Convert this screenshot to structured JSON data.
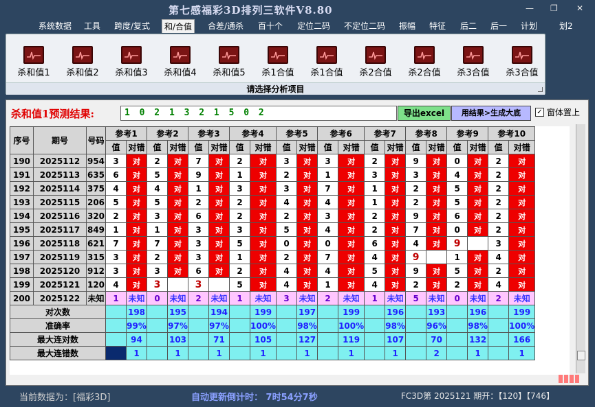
{
  "app": {
    "title": "第七感福彩3D排列三软件V8.80"
  },
  "window_controls": [
    "—",
    "❐",
    "✕"
  ],
  "menu": [
    "系统数据",
    "工具",
    "跨度/复式",
    "和/合值",
    "合差/通杀",
    "百十个",
    "定位二码",
    "不定位二码",
    "振幅",
    "特征",
    "后二",
    "后一",
    "计划",
    "划2"
  ],
  "menu_active": 3,
  "ribbon": {
    "tools": [
      "杀和值1",
      "杀和值2",
      "杀和值3",
      "杀和值4",
      "杀和值5",
      "杀1合值",
      "杀1合值",
      "杀2合值",
      "杀2合值",
      "杀3合值",
      "杀3合值"
    ],
    "caption": "请选择分析项目"
  },
  "panel": {
    "pred_label": "杀和值1预测结果:",
    "pred_value": "1 0 2 1 3 2 1 5 0 2",
    "export_label": "导出excel",
    "generate_label": "用结果>生成大底",
    "pin_label": "窗体置上",
    "pin_mark": "✓"
  },
  "table": {
    "col_headers": [
      "序号",
      "期号",
      "号码"
    ],
    "ref_headers": [
      "参考1",
      "参考2",
      "参考3",
      "参考4",
      "参考5",
      "参考6",
      "参考7",
      "参考8",
      "参考9",
      "参考10"
    ],
    "sub_headers": [
      "值",
      "对错"
    ],
    "hit_text": "对",
    "rows": [
      {
        "seq": "190",
        "issue": "2025112",
        "num": "954",
        "vals": [
          "3",
          "2",
          "7",
          "2",
          "3",
          "3",
          "2",
          "9",
          "0",
          "2"
        ],
        "miss": []
      },
      {
        "seq": "191",
        "issue": "2025113",
        "num": "635",
        "vals": [
          "6",
          "5",
          "9",
          "1",
          "2",
          "1",
          "3",
          "3",
          "4",
          "2"
        ],
        "miss": []
      },
      {
        "seq": "192",
        "issue": "2025114",
        "num": "375",
        "vals": [
          "4",
          "4",
          "1",
          "3",
          "3",
          "7",
          "1",
          "2",
          "5",
          "2"
        ],
        "miss": []
      },
      {
        "seq": "193",
        "issue": "2025115",
        "num": "206",
        "vals": [
          "5",
          "5",
          "2",
          "2",
          "4",
          "4",
          "1",
          "2",
          "5",
          "2"
        ],
        "miss": []
      },
      {
        "seq": "194",
        "issue": "2025116",
        "num": "320",
        "vals": [
          "2",
          "3",
          "6",
          "2",
          "2",
          "3",
          "2",
          "9",
          "6",
          "2"
        ],
        "miss": []
      },
      {
        "seq": "195",
        "issue": "2025117",
        "num": "849",
        "vals": [
          "1",
          "1",
          "3",
          "3",
          "5",
          "4",
          "2",
          "7",
          "0",
          "2"
        ],
        "miss": []
      },
      {
        "seq": "196",
        "issue": "2025118",
        "num": "621",
        "vals": [
          "7",
          "7",
          "3",
          "5",
          "0",
          "0",
          "6",
          "4",
          "9",
          "3"
        ],
        "miss": [
          8
        ]
      },
      {
        "seq": "197",
        "issue": "2025119",
        "num": "315",
        "vals": [
          "3",
          "2",
          "3",
          "1",
          "2",
          "7",
          "4",
          "9",
          "1",
          "4"
        ],
        "miss": [
          7
        ]
      },
      {
        "seq": "198",
        "issue": "2025120",
        "num": "912",
        "vals": [
          "3",
          "3",
          "6",
          "2",
          "4",
          "4",
          "5",
          "9",
          "5",
          "2"
        ],
        "miss": []
      },
      {
        "seq": "199",
        "issue": "2025121",
        "num": "120",
        "vals": [
          "4",
          "3",
          "3",
          "5",
          "4",
          "1",
          "4",
          "2",
          "2",
          "4"
        ],
        "miss": [
          1,
          2
        ]
      }
    ],
    "predict_row": {
      "seq": "200",
      "issue": "2025122",
      "num": "未知",
      "vals": [
        "1",
        "0",
        "2",
        "1",
        "3",
        "2",
        "1",
        "5",
        "0",
        "2"
      ],
      "status": "未知"
    },
    "stats": [
      {
        "label": "对次数",
        "vals": [
          "198",
          "195",
          "194",
          "199",
          "197",
          "199",
          "196",
          "193",
          "196",
          "199"
        ]
      },
      {
        "label": "准确率",
        "vals": [
          "99%",
          "97%",
          "97%",
          "100%",
          "98%",
          "100%",
          "98%",
          "96%",
          "98%",
          "100%"
        ]
      },
      {
        "label": "最大连对数",
        "vals": [
          "94",
          "103",
          "71",
          "105",
          "127",
          "119",
          "107",
          "70",
          "132",
          "166"
        ]
      },
      {
        "label": "最大连错数",
        "vals": [
          "1",
          "1",
          "1",
          "1",
          "1",
          "1",
          "1",
          "2",
          "1",
          "1"
        ]
      }
    ]
  },
  "status": {
    "current": "当前数据为：[福彩3D]",
    "auto_update": "自动更新倒计时：  7时54分7秒",
    "issue": "FC3D第 2025121 期开：【120】【746】"
  }
}
